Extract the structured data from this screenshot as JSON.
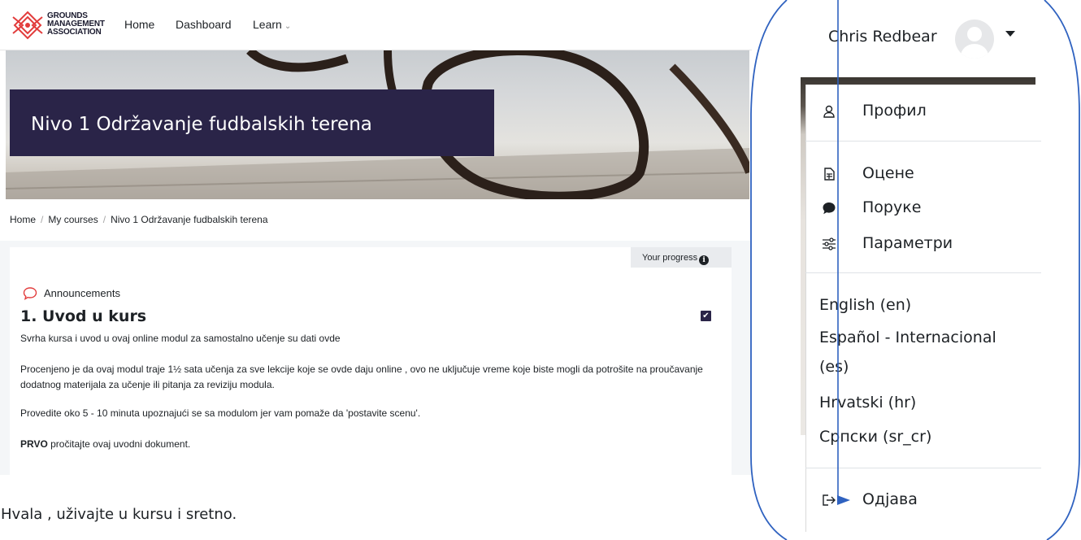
{
  "navbar": {
    "logo_lines": [
      "GROUNDS",
      "MANAGEMENT",
      "ASSOCIATION"
    ],
    "links": [
      {
        "label": "Home"
      },
      {
        "label": "Dashboard"
      },
      {
        "label": "Learn"
      }
    ],
    "learn_caret": "⌄"
  },
  "hero": {
    "title": "Nivo 1 Održavanje fudbalskih terena"
  },
  "breadcrumb": [
    {
      "label": "Home"
    },
    {
      "label": "My courses"
    },
    {
      "label": "Nivo 1 Održavanje fudbalskih terena"
    }
  ],
  "course": {
    "progress_label": "Your progress",
    "info_glyph": "i",
    "announcements_label": "Announcements",
    "section_title": "1. Uvod u kurs",
    "checkbox_glyph": "✔",
    "paragraphs": [
      "Svrha kursa i uvod u ovaj online modul za samostalno učenje su dati ovde",
      "Procenjeno je da ovaj modul traje 1½ sata učenja za sve lekcije koje se ovde daju online , ovo ne uključuje vreme koje biste mogli da potrošite na proučavanje dodatnog materijala za učenje ili pitanja za reviziju  modula.",
      "Provedite oko 5 - 10 minuta upoznajući se sa modulom jer vam pomaže da 'postavite scenu'."
    ],
    "first_prefix": "PRVO",
    "first_rest": " pročitajte ovaj uvodni dokument."
  },
  "footer_note": "Hvala , uživajte u kursu i sretno.",
  "user_menu": {
    "user_name": "Chris Redbear",
    "items": [
      {
        "label": "Профил",
        "icon": "user-icon"
      },
      {
        "label": "Оцене",
        "icon": "grades-table-icon"
      },
      {
        "label": "Поруке",
        "icon": "message-bubble-icon"
      },
      {
        "label": "Параметри",
        "icon": "sliders-icon"
      }
    ],
    "languages": [
      {
        "label": "English (en)"
      },
      {
        "label": "Español - Internacional",
        "cont": "(es)"
      },
      {
        "label": "Hrvatski (hr)"
      },
      {
        "label": "Српски (sr_cr)"
      }
    ],
    "logout": {
      "label": "Одјава",
      "icon": "sign-out-icon"
    }
  },
  "colors": {
    "title_box": "#2a2448",
    "annotation": "#2f62c0",
    "announce_icon": "#e23c3c"
  }
}
